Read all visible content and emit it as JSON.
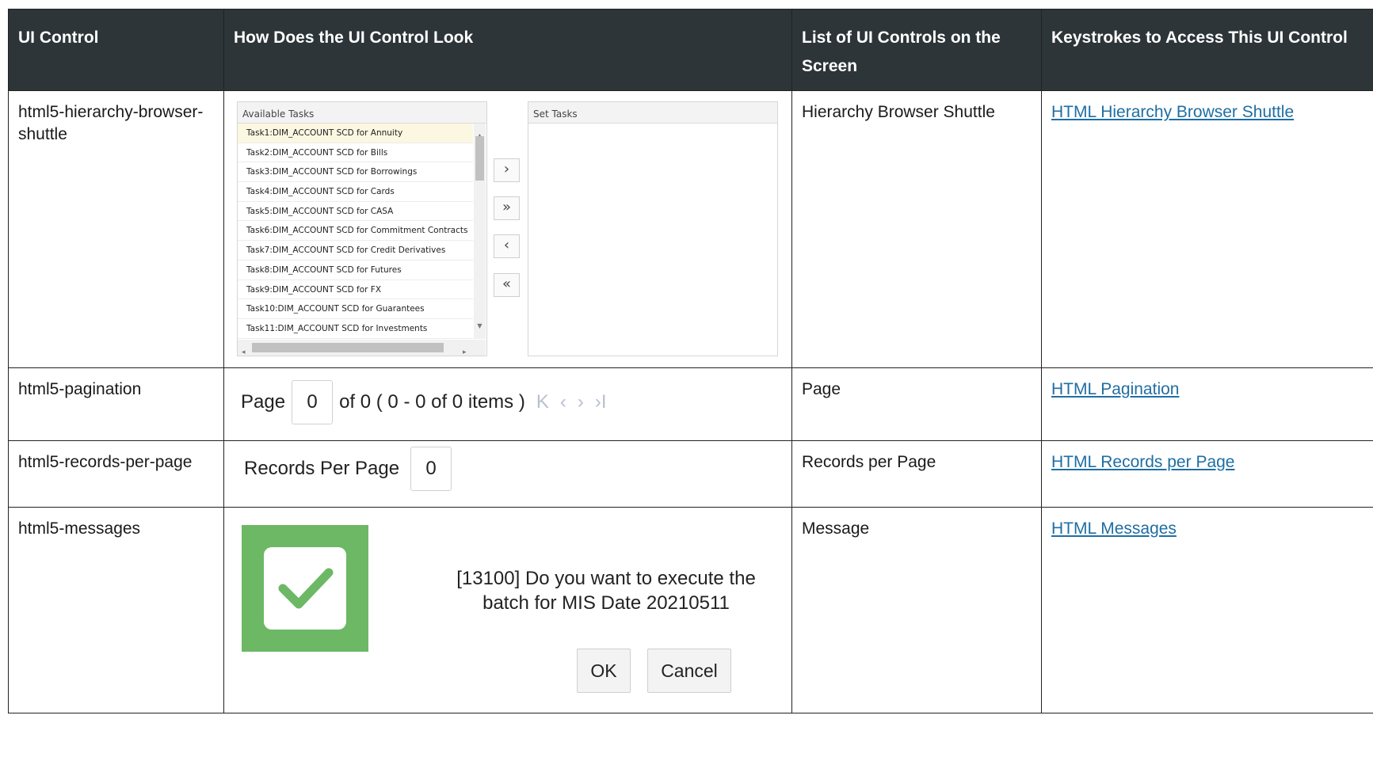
{
  "headers": {
    "col1": "UI Control",
    "col2": "How Does the UI Control Look",
    "col3": "List of UI Controls on the Screen",
    "col4": "Keystrokes to Access This UI Control"
  },
  "rows": [
    {
      "control": "html5-hierarchy-browser-shuttle",
      "list": "Hierarchy Browser Shuttle",
      "link": "HTML Hierarchy Browser Shuttle"
    },
    {
      "control": "html5-pagination",
      "list": "Page",
      "link": "HTML Pagination"
    },
    {
      "control": "html5-records-per-page",
      "list": "Records per Page",
      "link": "HTML Records per Page"
    },
    {
      "control": "html5-messages",
      "list": "Message",
      "link": "HTML Messages"
    }
  ],
  "shuttle": {
    "available_title": "Available Tasks",
    "set_title": "Set Tasks",
    "tasks": [
      "Task1:DIM_ACCOUNT SCD for Annuity",
      "Task2:DIM_ACCOUNT SCD for Bills",
      "Task3:DIM_ACCOUNT SCD for Borrowings",
      "Task4:DIM_ACCOUNT SCD for Cards",
      "Task5:DIM_ACCOUNT SCD for CASA",
      "Task6:DIM_ACCOUNT SCD for Commitment Contracts",
      "Task7:DIM_ACCOUNT SCD for Credit Derivatives",
      "Task8:DIM_ACCOUNT SCD for Futures",
      "Task9:DIM_ACCOUNT SCD for FX",
      "Task10:DIM_ACCOUNT SCD for Guarantees",
      "Task11:DIM_ACCOUNT SCD for Investments"
    ],
    "buttons": {
      "move_right": "›",
      "move_all_right": "»",
      "move_left": "‹",
      "move_all_left": "«"
    }
  },
  "pagination": {
    "page_label": "Page",
    "page_value": "0",
    "summary": "of 0 ( 0 - 0 of 0 items )",
    "icons": {
      "first": "K",
      "prev": "‹",
      "next": "›",
      "last": "›I"
    }
  },
  "records": {
    "label": "Records Per Page",
    "value": "0"
  },
  "message": {
    "text": "[13100] Do you want to execute the batch for MIS Date 20210511",
    "ok": "OK",
    "cancel": "Cancel",
    "icon": "success-check-icon",
    "icon_color": "#6cb865"
  }
}
